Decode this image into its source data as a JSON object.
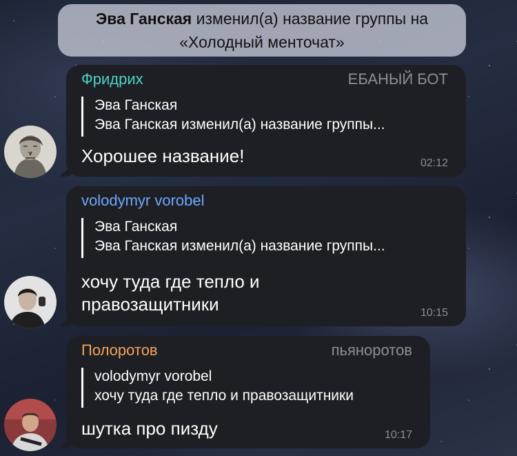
{
  "service_message": {
    "actor": "Эва Ганская",
    "action": " изменил(а) название группы на",
    "new_name": "«Холодный менточат»"
  },
  "messages": [
    {
      "sender": "Фридрих",
      "sender_color": "#4fd1c5",
      "role": "ЕБАНЫЙ БОТ",
      "reply_name": "Эва Ганская",
      "reply_text": "Эва Ганская изменил(а) название группы...",
      "text": "Хорошее название!",
      "time": "02:12",
      "avatar_icon": "engraving-portrait-avatar"
    },
    {
      "sender": "volodymyr vorobel",
      "sender_color": "#6ea8ff",
      "role": "",
      "reply_name": "Эва Ганская",
      "reply_text": "Эва Ганская изменил(а) название группы...",
      "text_line1": "хочу туда где тепло и",
      "text_line2": "правозащитники",
      "time": "10:15",
      "avatar_icon": "photo-avatar"
    },
    {
      "sender": "Полоротов",
      "sender_color": "#f5a35b",
      "role": "пьяноротов",
      "reply_name": "volodymyr vorobel",
      "reply_text": "хочу туда где тепло и правозащитники",
      "text": "шутка про пизду",
      "time": "10:17",
      "avatar_icon": "photo-avatar"
    }
  ]
}
